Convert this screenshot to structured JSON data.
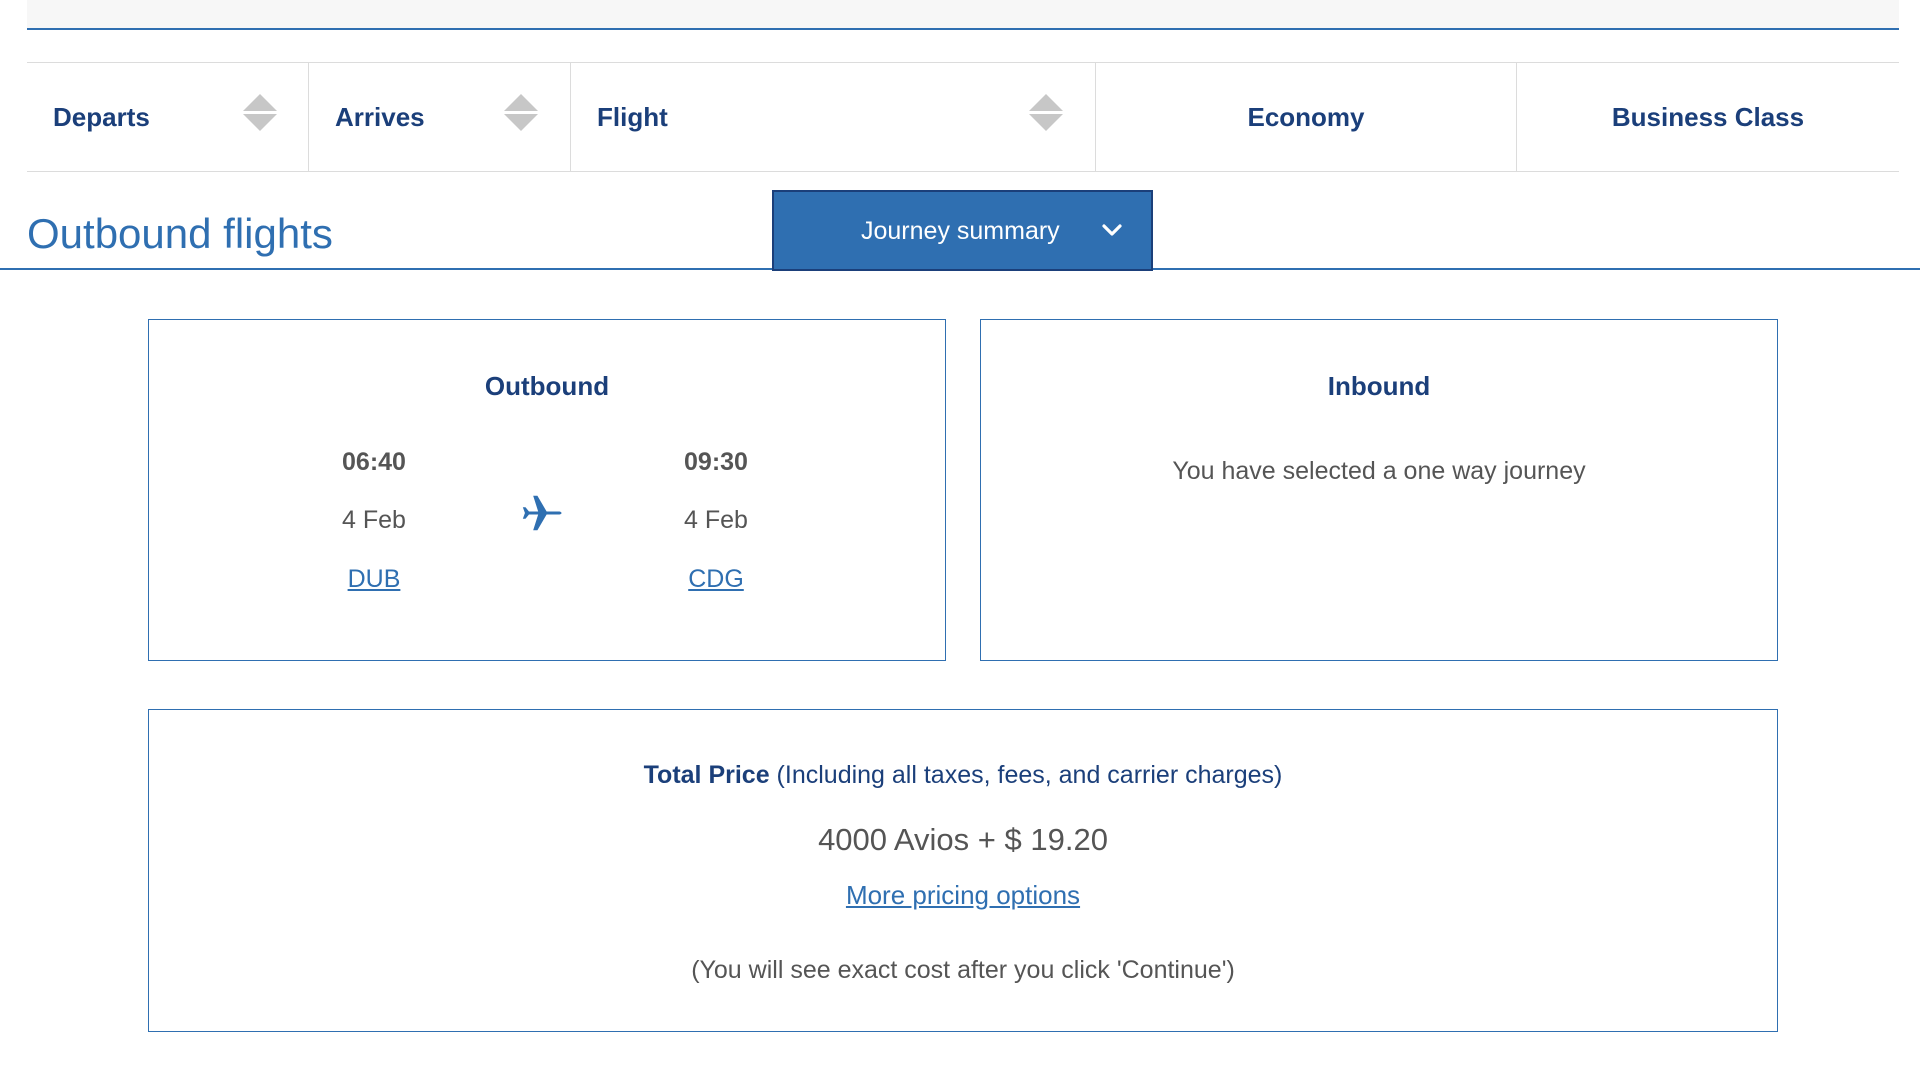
{
  "table_header": {
    "columns": [
      {
        "label": "Departs",
        "sortable": true
      },
      {
        "label": "Arrives",
        "sortable": true
      },
      {
        "label": "Flight",
        "sortable": true
      },
      {
        "label": "Economy",
        "sortable": false
      },
      {
        "label": "Business Class",
        "sortable": false
      }
    ]
  },
  "section": {
    "title": "Outbound flights"
  },
  "journey_summary": {
    "label": "Journey summary",
    "expand_icon": "chevron-down-icon"
  },
  "outbound": {
    "title": "Outbound",
    "depart": {
      "time": "06:40",
      "date": "4 Feb",
      "code": "DUB"
    },
    "arrive": {
      "time": "09:30",
      "date": "4 Feb",
      "code": "CDG"
    },
    "icon": "plane-icon"
  },
  "inbound": {
    "title": "Inbound",
    "message": "You have selected a one way journey"
  },
  "price": {
    "heading_strong": "Total Price",
    "heading_rest": " (Including all taxes, fees, and carrier charges)",
    "value": "4000 Avios + $ 19.20",
    "more_options": "More pricing options",
    "note": "(You will see exact cost after you click 'Continue')"
  },
  "colors": {
    "brand_blue": "#2f6fb1",
    "navy": "#1b3f7a",
    "text_gray": "#555555",
    "divider": "#dcdcdc"
  }
}
